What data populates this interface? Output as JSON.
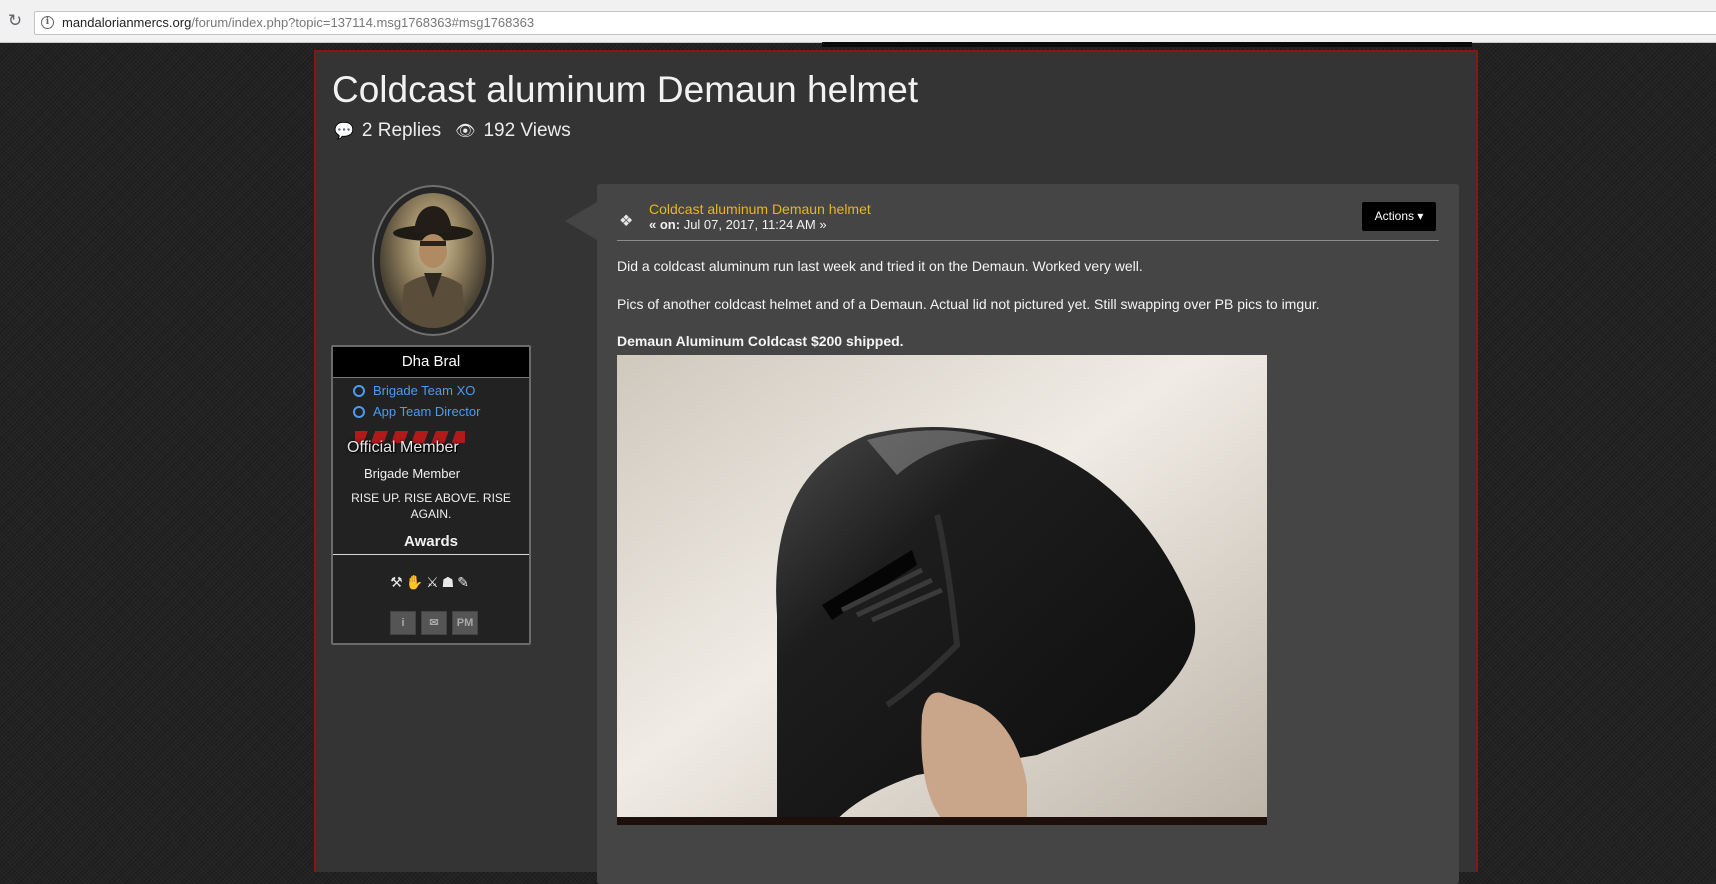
{
  "browser": {
    "url_host": "mandalorianmercs.org",
    "url_path": "/forum/index.php?topic=137114.msg1768363#msg1768363",
    "reload_icon": "reload-icon",
    "info_icon": "info-icon"
  },
  "topic": {
    "title": "Coldcast aluminum Demaun helmet",
    "replies": "2 Replies",
    "views": "192 Views"
  },
  "poster": {
    "name": "Dha Bral",
    "groups": [
      "Brigade Team XO",
      "App Team Director"
    ],
    "rank_title": "Official Member",
    "member_group": "Brigade Member",
    "motto": "RISE UP. RISE ABOVE. RISE AGAIN.",
    "awards_label": "Awards",
    "award_icons": [
      "award-icon",
      "award-icon",
      "award-icon",
      "award-icon",
      "award-icon"
    ],
    "profile_buttons": {
      "info": "i",
      "mail": "✉",
      "pm": "PM"
    }
  },
  "post": {
    "title": "Coldcast aluminum Demaun helmet",
    "date_prefix": "« on:",
    "date": "Jul 07, 2017, 11:24 AM »",
    "actions_label": "Actions ▾",
    "paragraphs": [
      "Did a coldcast aluminum run last week and tried it on the Demaun. Worked very well.",
      "Pics of another coldcast helmet and of a Demaun. Actual lid not pictured yet. Still swapping over PB pics to imgur."
    ],
    "price_line": "Demaun Aluminum Coldcast $200 shipped."
  },
  "colors": {
    "accent_title": "#e8b522",
    "border_red": "#8b1414",
    "group_blue": "#4b9cf0",
    "panel": "#343434",
    "post_bg": "#454545"
  }
}
